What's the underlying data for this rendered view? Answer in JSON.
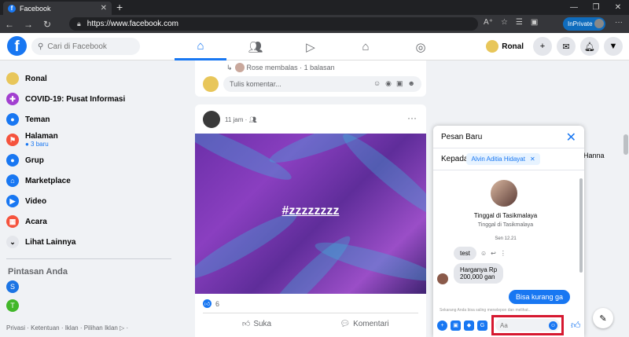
{
  "browser": {
    "tab_title": "Facebook",
    "url": "https://www.facebook.com",
    "inprivate_label": "InPrivate"
  },
  "fbnav": {
    "search_placeholder": "Cari di Facebook",
    "user_name": "Ronal"
  },
  "sidebar": {
    "items": [
      {
        "label": "Ronal",
        "sub": "",
        "icon": "user-avatar-icon",
        "color": "#e8c65a"
      },
      {
        "label": "COVID-19: Pusat Informasi",
        "sub": "",
        "icon": "covid-info-icon",
        "color": "#a23fd0"
      },
      {
        "label": "Teman",
        "sub": "",
        "icon": "friends-icon",
        "color": "#1877f2"
      },
      {
        "label": "Halaman",
        "sub": "● 3 baru",
        "icon": "pages-flag-icon",
        "color": "#f5533d"
      },
      {
        "label": "Grup",
        "sub": "",
        "icon": "groups-icon",
        "color": "#1877f2"
      },
      {
        "label": "Marketplace",
        "sub": "",
        "icon": "marketplace-icon",
        "color": "#1877f2"
      },
      {
        "label": "Video",
        "sub": "",
        "icon": "video-icon",
        "color": "#1877f2"
      },
      {
        "label": "Acara",
        "sub": "",
        "icon": "events-calendar-icon",
        "color": "#f5533d"
      },
      {
        "label": "Lihat Lainnya",
        "sub": "",
        "icon": "chevron-down-icon",
        "color": "#e4e6eb"
      }
    ],
    "shortcuts_title": "Pintasan Anda",
    "shortcuts": [
      {
        "letter": "S",
        "color": "#1b74e4"
      },
      {
        "letter": "T",
        "color": "#42b72a"
      }
    ],
    "footer": "Privasi · Ketentuan · Iklan · Pilihan Iklan ▷ ·"
  },
  "feed": {
    "reply_text": "Rose membalas · 1 balasan",
    "comment_placeholder": "Tulis komentar...",
    "post_time": "11 jam ·",
    "post_hashtag": "#zzzzzzzz",
    "like_count": "6",
    "like_label": "Suka",
    "comment_label": "Komentari"
  },
  "right": {
    "contact_name": "Hanna"
  },
  "chat": {
    "title": "Pesan Baru",
    "to_label": "Kepada",
    "recipient": "Alvin Aditia Hidayat",
    "location_line1": "Tinggal di Tasikmalaya",
    "location_line2": "Tinggal di Tasikmalaya",
    "time": "Sen 12.21",
    "msg1": "test",
    "msg2_line1": "Harganya Rp",
    "msg2_line2": "200,000 gan",
    "msg3": "Bisa kurang ga",
    "note": "Sekarang Anda bisa saling menelepon dan melihat...",
    "input_placeholder": "Aa",
    "highlight_color": "#d6182f"
  }
}
